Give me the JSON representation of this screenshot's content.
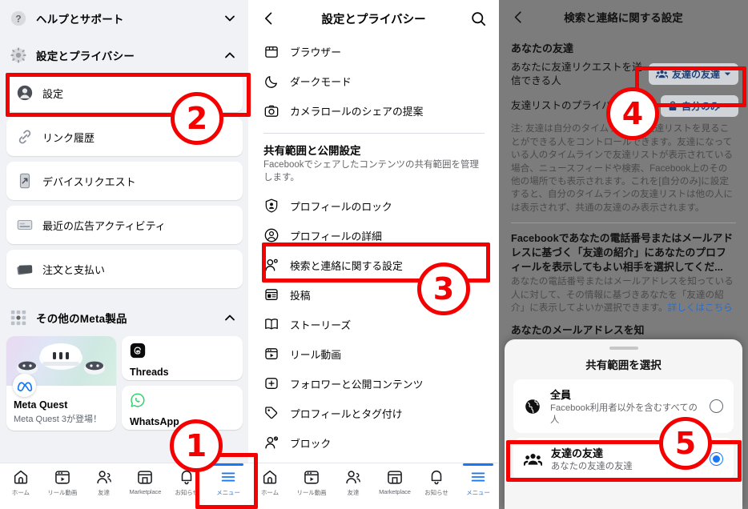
{
  "panel1": {
    "sections": [
      {
        "label": "ヘルプとサポート",
        "icon": "question-circle-icon",
        "chevron": "chevron-down"
      },
      {
        "label": "設定とプライバシー",
        "icon": "gear-icon",
        "chevron": "chevron-up"
      }
    ],
    "items": [
      {
        "label": "設定",
        "icon": "person-circle-icon"
      },
      {
        "label": "リンク履歴",
        "icon": "link-icon"
      },
      {
        "label": "デバイスリクエスト",
        "icon": "device-icon"
      },
      {
        "label": "最近の広告アクティビティ",
        "icon": "ad-activity-icon"
      },
      {
        "label": "注文と支払い",
        "icon": "orders-payments-icon"
      }
    ],
    "meta_section": {
      "label": "その他のMeta製品",
      "icon": "grid-dots-icon",
      "chevron": "chevron-up"
    },
    "meta_products": {
      "quest": {
        "title": "Meta Quest",
        "subtitle": "Meta Quest 3が登場！",
        "badge": "meta-logo-icon"
      },
      "threads": {
        "name": "Threads",
        "icon": "threads-icon"
      },
      "whatsapp": {
        "name": "WhatsApp",
        "icon": "whatsapp-icon"
      }
    },
    "bottom_nav": [
      {
        "label": "ホーム",
        "icon": "home-icon",
        "active": false
      },
      {
        "label": "リール動画",
        "icon": "reels-icon",
        "active": false
      },
      {
        "label": "友達",
        "icon": "friends-icon",
        "active": false
      },
      {
        "label": "Marketplace",
        "icon": "marketplace-icon",
        "active": false
      },
      {
        "label": "お知らせ",
        "icon": "bell-icon",
        "active": false
      },
      {
        "label": "メニュー",
        "icon": "hamburger-menu-icon",
        "active": true
      }
    ]
  },
  "panel2": {
    "header": {
      "title": "設定とプライバシー",
      "back": "back-chevron-icon",
      "search": "search-icon"
    },
    "top_items": [
      {
        "label": "ブラウザー",
        "icon": "browser-icon"
      },
      {
        "label": "ダークモード",
        "icon": "moon-icon"
      },
      {
        "label": "カメラロールのシェアの提案",
        "icon": "camera-icon"
      }
    ],
    "section": {
      "title": "共有範囲と公開設定",
      "description": "Facebookでシェアしたコンテンツの共有範囲を管理します。"
    },
    "section_items": [
      {
        "label": "プロフィールのロック",
        "icon": "profile-lock-icon"
      },
      {
        "label": "プロフィールの詳細",
        "icon": "profile-details-icon"
      },
      {
        "label": "検索と連絡に関する設定",
        "icon": "search-contact-icon"
      },
      {
        "label": "投稿",
        "icon": "posts-icon"
      },
      {
        "label": "ストーリーズ",
        "icon": "stories-icon"
      },
      {
        "label": "リール動画",
        "icon": "reels-icon"
      },
      {
        "label": "フォロワーと公開コンテンツ",
        "icon": "followers-icon"
      },
      {
        "label": "プロフィールとタグ付け",
        "icon": "tag-icon"
      },
      {
        "label": "ブロック",
        "icon": "block-icon"
      }
    ],
    "bottom_nav": [
      {
        "label": "ホーム",
        "icon": "home-icon",
        "active": false
      },
      {
        "label": "リール動画",
        "icon": "reels-icon",
        "active": false
      },
      {
        "label": "友達",
        "icon": "friends-icon",
        "active": false
      },
      {
        "label": "Marketplace",
        "icon": "marketplace-icon",
        "active": false
      },
      {
        "label": "お知らせ",
        "icon": "bell-icon",
        "active": false
      },
      {
        "label": "メニュー",
        "icon": "hamburger-menu-icon",
        "active": true
      }
    ]
  },
  "panel3": {
    "header": {
      "title": "検索と連絡に関する設定",
      "back": "back-chevron-icon"
    },
    "section_title": "あなたの友達",
    "row1": {
      "question": "あなたに友達リクエストを送信できる人",
      "value": "友達の友達",
      "icon": "friends-of-friends-icon",
      "chevron": "chevron-down"
    },
    "row2": {
      "question": "友達リストのプライバシー設定",
      "value": "自分のみ",
      "icon": "lock-icon",
      "chevron": "chevron-down"
    },
    "note": "注: 友達は自分のタイムラインの友達リストを見ることができる人をコントロールできます。友達になっている人のタイムラインで友達リストが表示されている場合、ニュースフィードや検索、Facebook上のその他の場所でも表示されます。これを[自分のみ]に設定すると、自分のタイムラインの友達リストは他の人には表示されず、共通の友達のみ表示されます。",
    "section2_title": "Facebookであなたの電話番号またはメールアドレスに基づく「友達の紹介」にあなたのプロフィールを表示してもよい相手を選択してくだ...",
    "section2_sub": "あなたの電話番号またはメールアドレスを知っている人に対して、その情報に基づきあなたを「友達の紹介」に表示してよいか選択できます。",
    "section2_link": "詳しくはこちら",
    "section3_partial": "あなたのメールアドレスを知",
    "sheet": {
      "title": "共有範囲を選択",
      "options": [
        {
          "title": "全員",
          "subtitle": "Facebook利用者以外を含むすべての人",
          "icon": "globe-icon",
          "selected": false
        },
        {
          "title": "友達の友達",
          "subtitle": "あなたの友達の友達",
          "icon": "friends-of-friends-icon",
          "selected": true
        }
      ]
    }
  },
  "annotations": {
    "accent_color": "#f40000",
    "steps": [
      {
        "number": "1"
      },
      {
        "number": "2"
      },
      {
        "number": "3"
      },
      {
        "number": "4"
      },
      {
        "number": "5"
      }
    ]
  }
}
